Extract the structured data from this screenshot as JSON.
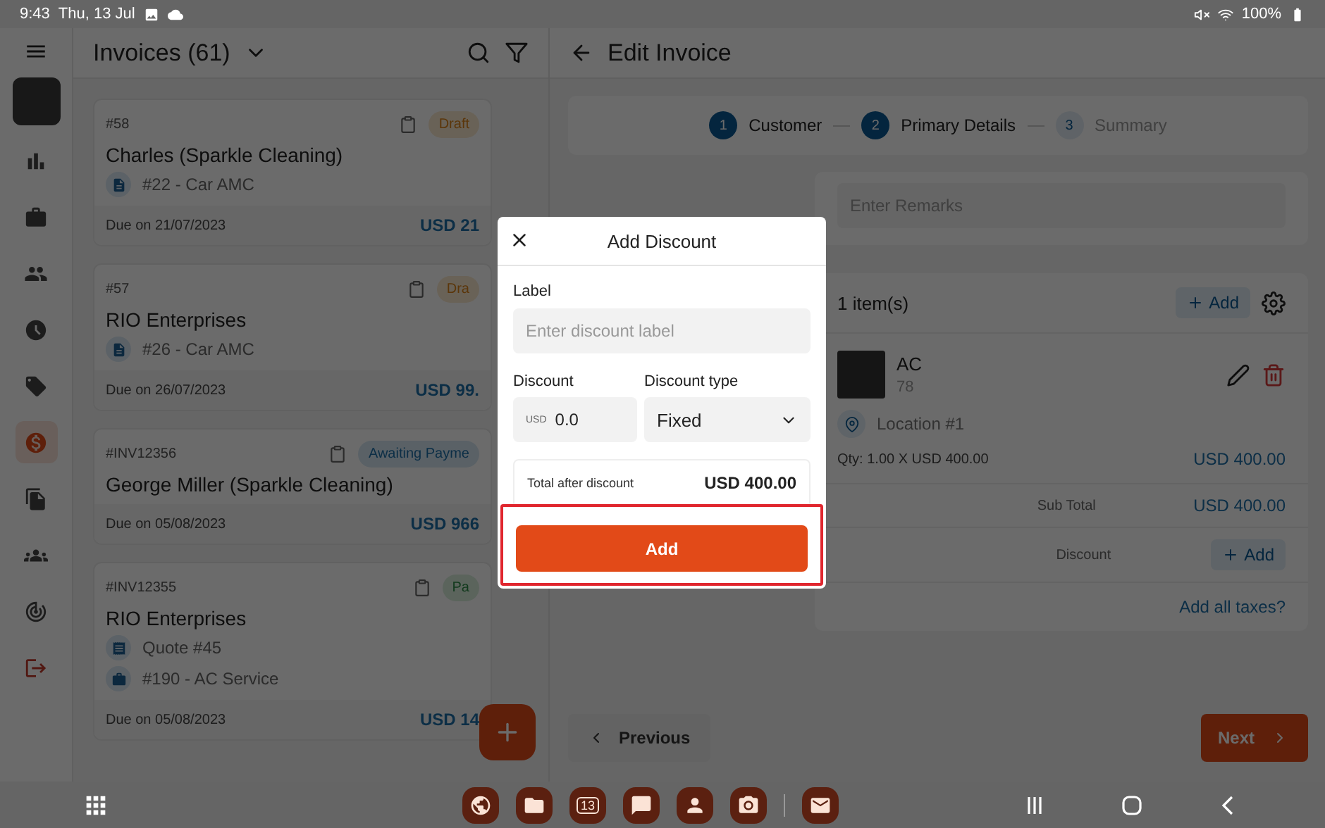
{
  "status_bar": {
    "time": "9:43",
    "date": "Thu, 13 Jul",
    "battery": "100%"
  },
  "sidebar": {
    "items": [
      {
        "selected": false
      },
      {
        "selected": false
      },
      {
        "selected": false
      },
      {
        "selected": false
      },
      {
        "selected": false
      },
      {
        "selected": true
      },
      {
        "selected": false
      },
      {
        "selected": false
      },
      {
        "selected": false
      },
      {
        "selected": false
      }
    ]
  },
  "invoice_list": {
    "title": "Invoices (61)",
    "cards": [
      {
        "number": "#58",
        "customer": "Charles (Sparkle Cleaning)",
        "refs": [
          {
            "kind": "job",
            "text": "#22 - Car AMC"
          }
        ],
        "due": "Due on 21/07/2023",
        "amount": "USD 21",
        "status": "Draft",
        "kind": "draft"
      },
      {
        "number": "#57",
        "customer": "RIO Enterprises",
        "refs": [
          {
            "kind": "job",
            "text": "#26 - Car AMC"
          }
        ],
        "due": "Due on 26/07/2023",
        "amount": "USD 99.",
        "status": "Dra",
        "kind": "draft"
      },
      {
        "number": "#INV12356",
        "customer": "George Miller (Sparkle Cleaning)",
        "due": "Due on 05/08/2023",
        "amount": "USD 966",
        "status": "Awaiting Payme",
        "kind": "awaiting"
      },
      {
        "number": "#INV12355",
        "customer": "RIO Enterprises",
        "refs": [
          {
            "kind": "quote",
            "text": "Quote #45"
          },
          {
            "kind": "work",
            "text": "#190 - AC Service"
          }
        ],
        "due": "Due on 05/08/2023",
        "amount": "USD 14",
        "status": "Pa",
        "kind": "paid"
      }
    ]
  },
  "editor": {
    "title": "Edit Invoice",
    "steps": [
      {
        "number": "1",
        "label": "Customer",
        "completed": true
      },
      {
        "number": "2",
        "label": "Primary Details",
        "completed": true
      },
      {
        "number": "3",
        "label": "Summary",
        "completed": false
      }
    ],
    "remarks": {
      "placeholder": "Enter Remarks"
    },
    "items": {
      "count": "1 item(s)",
      "add_button": "Add",
      "entries": [
        {
          "name": "AC",
          "code": "78",
          "location": "Location #1",
          "qty": "Qty: 1.00 X USD 400.00",
          "amount": "USD 400.00"
        }
      ],
      "subtotal_label": "Sub Total",
      "subtotal_value": "USD 400.00",
      "discount_label": "Discount",
      "discount_button": "Add",
      "taxes_link": "Add all taxes?"
    },
    "previous_button": "Previous",
    "next_button": "Next"
  },
  "dialog": {
    "title": "Add Discount",
    "label_label": "Label",
    "label_placeholder": "Enter discount label",
    "discount_label": "Discount",
    "currency": "USD",
    "discount_value": "0.0",
    "type_label": "Discount type",
    "type_value": "Fixed",
    "total_label": "Total after discount",
    "total_value": "USD 400.00",
    "add_button": "Add",
    "add_highlighted": true
  },
  "taskbar": {
    "calendar_day": "13"
  }
}
